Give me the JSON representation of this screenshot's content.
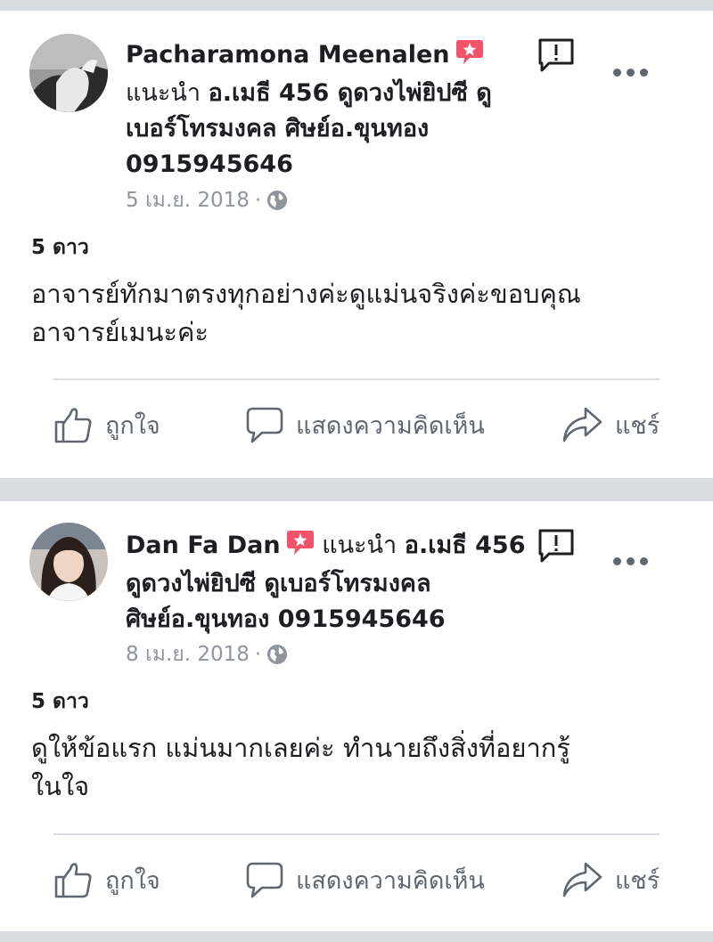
{
  "colors": {
    "background": "#dadde1",
    "card": "#ffffff",
    "badge": "#f35369",
    "meta": "#90949c",
    "action": "#606770"
  },
  "posts": [
    {
      "author": "Pacharamona Meenalen",
      "recommend": "แนะนำ",
      "page_line1": "อ.เมธี 456 ดูดวงไพ่ยิปซี ดู",
      "page_line2": "เบอร์โทรมงคล ศิษย์อ.ขุนทอง",
      "page_line3": "0915945646",
      "date": "5 เม.ย. 2018",
      "separator": "·",
      "rating": "5 ดาว",
      "body_line1": "อาจารย์ทักมาตรงทุกอย่างค่ะดูแม่นจริงค่ะขอบคุณ",
      "body_line2": "อาจารย์เมนะค่ะ",
      "actions": {
        "like": "ถูกใจ",
        "comment": "แสดงความคิดเห็น",
        "share": "แชร์"
      },
      "icons": [
        "avatar",
        "recommend-badge-icon",
        "report-icon",
        "more-icon",
        "globe-icon",
        "like-icon",
        "comment-icon",
        "share-icon"
      ]
    },
    {
      "author": "Dan Fa Dan",
      "recommend": "แนะนำ",
      "page_line1": "อ.เมธี 456",
      "page_line2": "ดูดวงไพ่ยิปซี ดูเบอร์โทรมงคล",
      "page_line3": "ศิษย์อ.ขุนทอง 0915945646",
      "date": "8 เม.ย. 2018",
      "separator": "·",
      "rating": "5 ดาว",
      "body_line1": "ดูให้ข้อแรก แม่นมากเลยค่ะ ทำนายถึงสิ่งที่อยากรู้",
      "body_line2": "ในใจ",
      "actions": {
        "like": "ถูกใจ",
        "comment": "แสดงความคิดเห็น",
        "share": "แชร์"
      },
      "icons": [
        "avatar",
        "recommend-badge-icon",
        "report-icon",
        "more-icon",
        "globe-icon",
        "like-icon",
        "comment-icon",
        "share-icon"
      ]
    }
  ]
}
